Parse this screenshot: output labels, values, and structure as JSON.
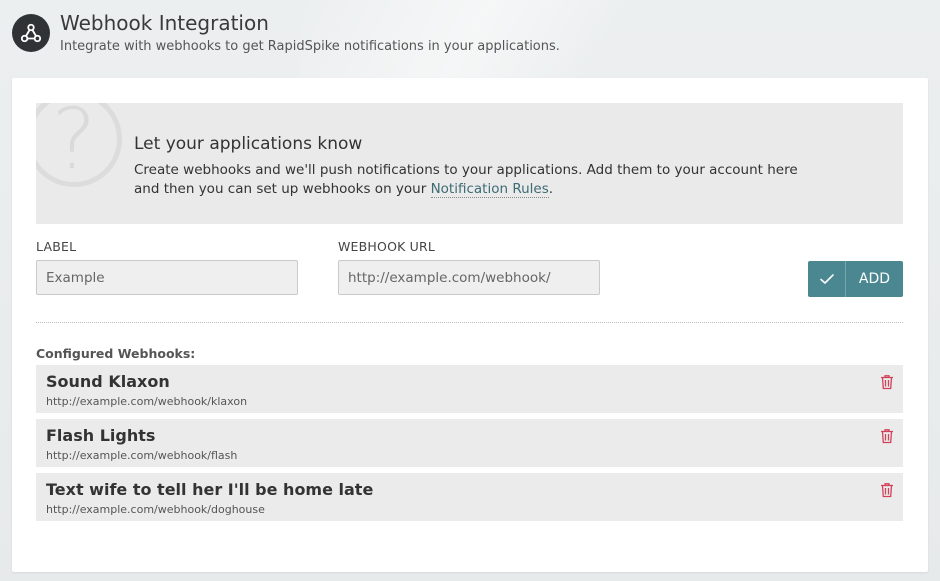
{
  "header": {
    "icon": "webhook-icon",
    "title": "Webhook Integration",
    "subtitle": "Integrate with webhooks to get RapidSpike notifications in your applications."
  },
  "info": {
    "icon": "question-mark-icon",
    "title": "Let your applications know",
    "body_before": "Create webhooks and we'll push notifications to your applications. Add them to your account here and then you can set up webhooks on your ",
    "link_text": "Notification Rules",
    "body_after": "."
  },
  "form": {
    "label_label": "LABEL",
    "label_placeholder": "Example",
    "url_label": "WEBHOOK URL",
    "url_placeholder": "http://example.com/webhook/",
    "add_label": "ADD",
    "add_icon": "check-icon"
  },
  "webhooks": {
    "title": "Configured Webhooks:",
    "delete_icon": "trash-icon",
    "items": [
      {
        "name": "Sound Klaxon",
        "url": "http://example.com/webhook/klaxon"
      },
      {
        "name": "Flash Lights",
        "url": "http://example.com/webhook/flash"
      },
      {
        "name": "Text wife to tell her I'll be home late",
        "url": "http://example.com/webhook/doghouse"
      }
    ]
  },
  "colors": {
    "accent": "#4a8791",
    "delete": "#d0415a"
  }
}
